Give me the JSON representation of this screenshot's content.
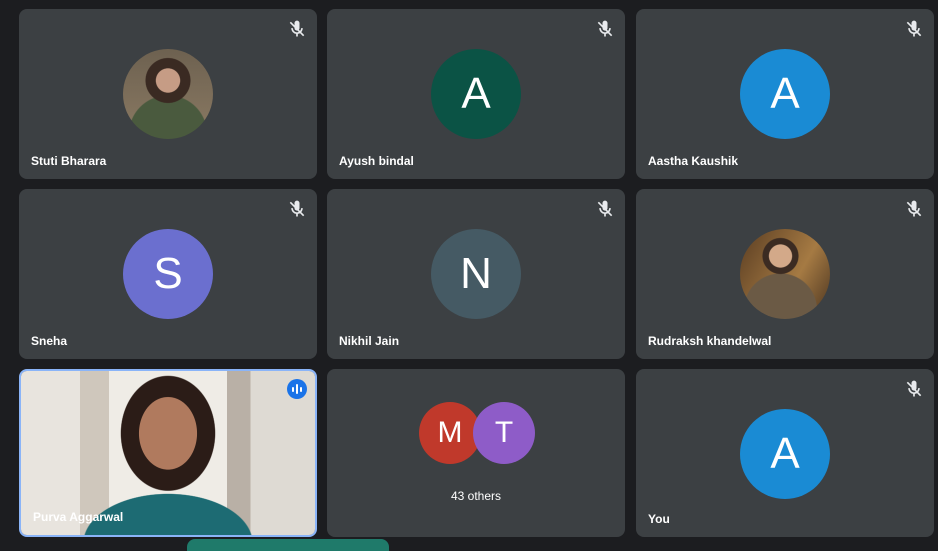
{
  "participants": [
    {
      "name": "Stuti Bharara",
      "initial": "",
      "color": "",
      "muted": true,
      "photo": true
    },
    {
      "name": "Ayush bindal",
      "initial": "A",
      "color": "#0b5345",
      "muted": true
    },
    {
      "name": "Aastha Kaushik",
      "initial": "A",
      "color": "#1a8bd4",
      "muted": true
    },
    {
      "name": "Sneha",
      "initial": "S",
      "color": "#6b6fcf",
      "muted": true
    },
    {
      "name": "Nikhil Jain",
      "initial": "N",
      "color": "#455a64",
      "muted": true
    },
    {
      "name": "Rudraksh khandelwal",
      "initial": "",
      "color": "",
      "muted": true,
      "photo": true
    },
    {
      "name": "Purva Aggarwal",
      "speaking": true,
      "video": true
    },
    {
      "others_label": "43 others",
      "initials": [
        "M",
        "T"
      ],
      "colors": [
        "#c0392b",
        "#8e5cc8"
      ]
    },
    {
      "name": "You",
      "initial": "A",
      "color": "#1a8bd4",
      "muted": true
    }
  ]
}
